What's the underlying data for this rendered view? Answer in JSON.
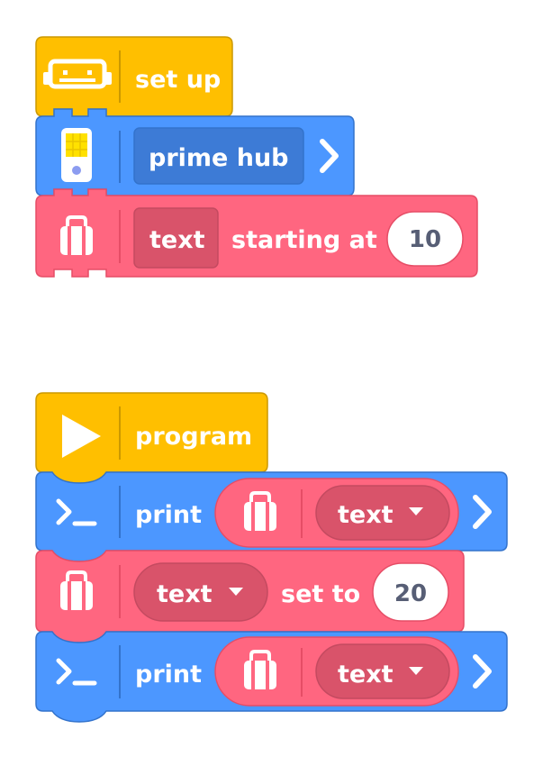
{
  "colors": {
    "events": "#ffbf00",
    "events_stroke": "#cc9900",
    "hub": "#4c97ff",
    "hub_stroke": "#3373cc",
    "hub_dark": "#3d7bd6",
    "variables": "#ff6680",
    "variables_stroke": "#e64d66",
    "variables_dark": "#d9536a",
    "value_text": "#575e75"
  },
  "setup_stack": {
    "hat": {
      "icon": "robot-hub-icon",
      "label": "set up"
    },
    "hub_block": {
      "icon": "hub-icon",
      "value": "prime hub",
      "arrow_icon": "chevron-right-icon"
    },
    "variable_block": {
      "icon": "bag-icon",
      "variable": "text",
      "label": "starting at",
      "value": "10"
    }
  },
  "program_stack": {
    "hat": {
      "icon": "play-icon",
      "label": "program"
    },
    "blocks": [
      {
        "type": "print",
        "icon": "terminal-icon",
        "label": "print",
        "reporter_icon": "bag-icon",
        "variable": "text",
        "dropdown_icon": "dropdown-arrow-icon",
        "arrow_icon": "chevron-right-icon"
      },
      {
        "type": "set",
        "icon": "bag-icon",
        "variable": "text",
        "dropdown_icon": "dropdown-arrow-icon",
        "label": "set to",
        "value": "20"
      },
      {
        "type": "print",
        "icon": "terminal-icon",
        "label": "print",
        "reporter_icon": "bag-icon",
        "variable": "text",
        "dropdown_icon": "dropdown-arrow-icon",
        "arrow_icon": "chevron-right-icon"
      }
    ]
  }
}
